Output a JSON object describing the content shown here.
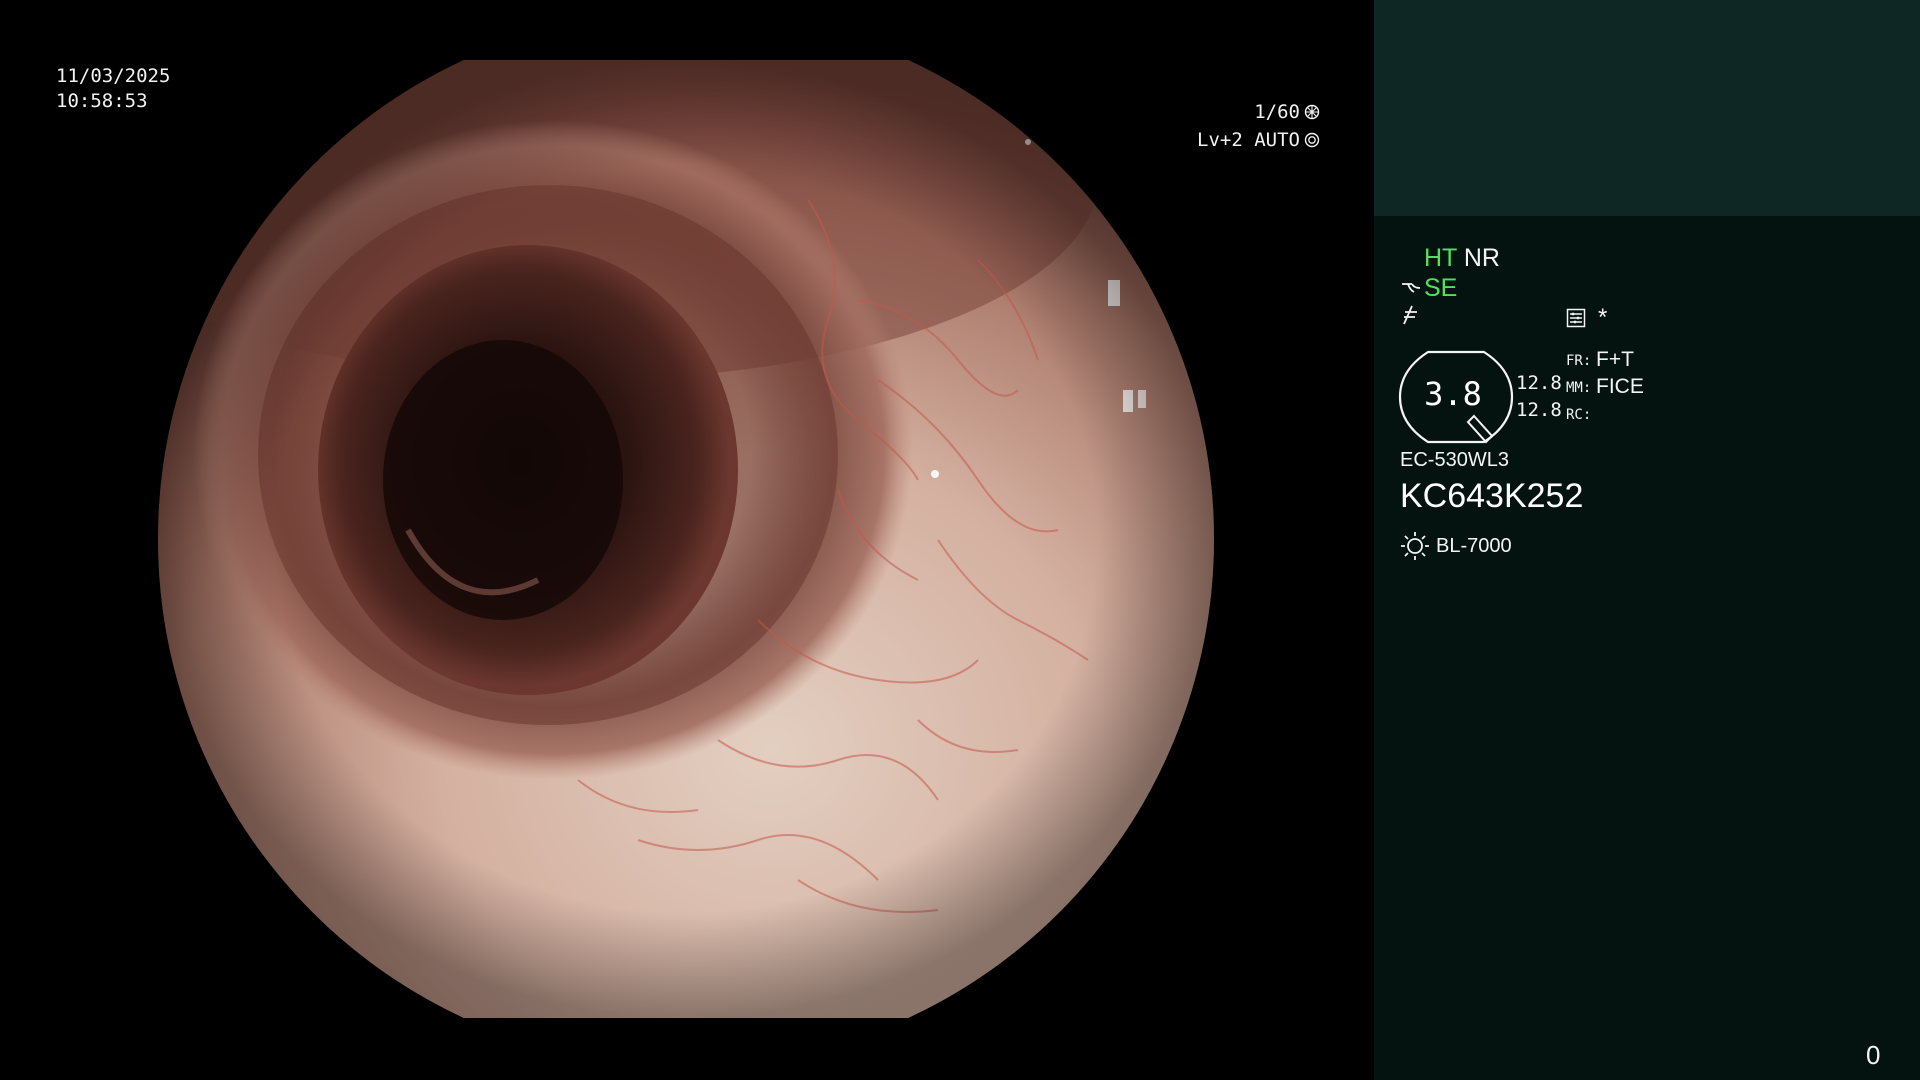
{
  "overlay": {
    "date": "11/03/2025",
    "time": "10:58:53",
    "shutter": "1/60",
    "level": "Lv+2 AUTO",
    "shutter_icon": "shutter-icon",
    "auto_icon": "iris-icon"
  },
  "panel": {
    "ht_label": "HT",
    "nr_label": "NR",
    "se_label": "SE",
    "se_icon": "enhancement-icon",
    "f_icon": "filter-icon",
    "menu_icon": "memo-icon",
    "star": "*",
    "gauge_value": "3.8",
    "num_top": "12.8",
    "num_bottom": "12.8",
    "fr_label": "FR:",
    "mm_label": "MM:",
    "rc_label": "RC:",
    "fr_value": "F+T",
    "mm_value": "FICE",
    "rc_value": "",
    "scope_model": "EC-530WL3",
    "scope_serial": "KC643K252",
    "light_icon": "light-source-icon",
    "light_source": "BL-7000",
    "counter": "0"
  },
  "colors": {
    "panel_top": "#0e2624",
    "panel_body": "#051310",
    "accent_green": "#4fe35a"
  }
}
